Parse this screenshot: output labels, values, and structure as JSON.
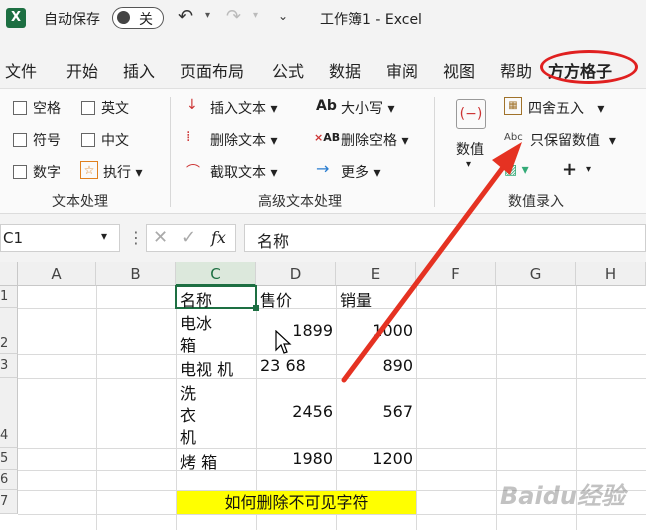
{
  "titlebar": {
    "logo": "X",
    "autosave": "自动保存",
    "toggle": "关",
    "title": "工作簿1 - Excel",
    "undo_icon": "undo-icon",
    "redo_icon": "redo-icon"
  },
  "menu": {
    "items": [
      "文件",
      "开始",
      "插入",
      "页面布局",
      "公式",
      "数据",
      "审阅",
      "视图",
      "帮助"
    ],
    "plugin": "方方格子"
  },
  "ribbon": {
    "text_group": {
      "label": "文本处理",
      "items": [
        "空格",
        "英文",
        "符号",
        "中文",
        "数字",
        "执行"
      ]
    },
    "adv_group": {
      "label": "高级文本处理",
      "items": [
        "插入文本",
        "删除文本",
        "截取文本",
        "大小写",
        "删除空格",
        "更多"
      ],
      "icon_ab": "Ab",
      "icon_ab2": "AB"
    },
    "num_group": {
      "label": "数值录入",
      "value_btn": "数值",
      "round": "四舍五入",
      "keep": "只保留数值",
      "abc": "Abc",
      "plus": "+"
    }
  },
  "formula_bar": {
    "name_box": "C1",
    "fx": "fx",
    "content": "名称"
  },
  "columns": [
    "A",
    "B",
    "C",
    "D",
    "E",
    "F",
    "G",
    "H"
  ],
  "rows": [
    "1",
    "2",
    "3",
    "4",
    "5",
    "6",
    "7"
  ],
  "cells": {
    "c1": "名称",
    "d1": "售价",
    "e1": "销量",
    "c2a": "电冰",
    "c2b": "箱",
    "d2": "1899",
    "e2": "1000",
    "c3": "电视 机",
    "d3": "23 68",
    "e3": "890",
    "c4a": "洗",
    "c4b": "衣",
    "c4c": "机",
    "d4": "2456",
    "e4": "567",
    "c5": "烤 箱",
    "d5": "1980",
    "e5": "1200",
    "c7": "如何删除不可见字符"
  },
  "colors": {
    "highlight": "#ffff00",
    "accent_red": "#e02020",
    "excel_green": "#1d6f42"
  },
  "watermark": "Baidu经验"
}
